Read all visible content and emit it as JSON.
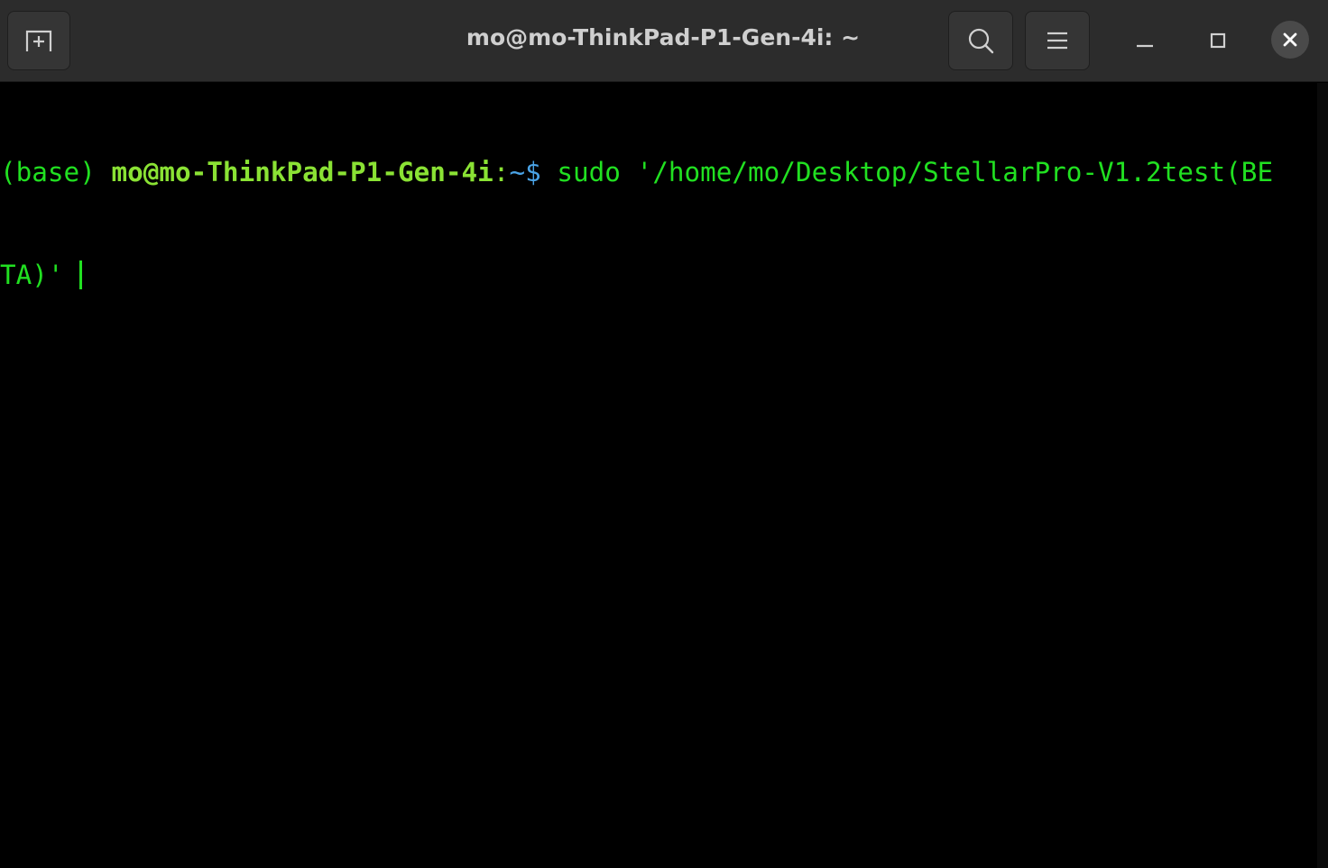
{
  "window": {
    "title": "mo@mo-ThinkPad-P1-Gen-4i: ~"
  },
  "titlebar": {
    "new_tab_icon": "new-tab-icon",
    "search_icon": "search-icon",
    "menu_icon": "hamburger-menu-icon",
    "minimize_icon": "minimize-icon",
    "maximize_icon": "maximize-icon",
    "close_icon": "close-icon"
  },
  "terminal": {
    "line1": {
      "env": "(base) ",
      "user": "mo@mo-ThinkPad-P1-Gen-4i",
      "colon": ":",
      "path": "~",
      "symbol": "$ ",
      "command": "sudo '/home/mo/Desktop/StellarPro-V1.2test(BE"
    },
    "line2": {
      "command": "TA)' "
    }
  },
  "colors": {
    "background": "#000000",
    "titlebar": "#2c2c2c",
    "text_green": "#21e021",
    "user_green": "#8ae234",
    "path_blue": "#4aa3e6"
  }
}
